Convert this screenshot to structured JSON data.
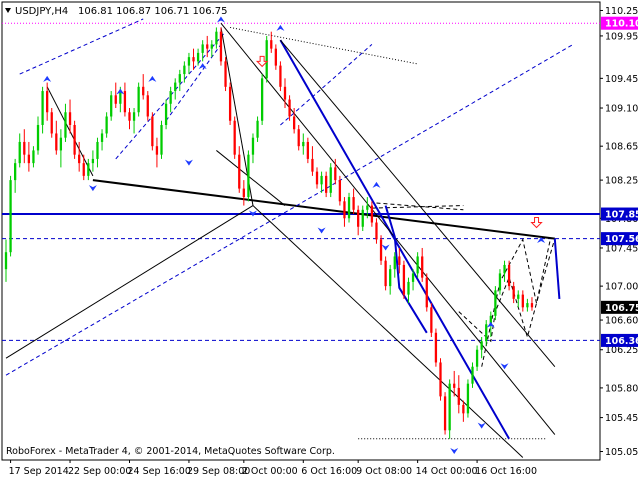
{
  "chart_data": {
    "type": "candlestick",
    "header": {
      "symbol": "USDJPY,H4",
      "ohlc": "106.81 106.87 106.71 106.75"
    },
    "footer": "RoboForex - MetaTrader 4, © 2001-2014, MetaQuotes Software Corp.",
    "ylim": [
      104.95,
      110.35
    ],
    "xlim": [
      0,
      129
    ],
    "y_ticks": [
      "110.25",
      "109.95",
      "109.45",
      "109.10",
      "108.65",
      "108.25",
      "107.80",
      "107.45",
      "107.00",
      "106.60",
      "106.25",
      "105.80",
      "105.45",
      "105.05"
    ],
    "x_ticks": [
      {
        "label": "17 Sep 2014",
        "x": 1
      },
      {
        "label": "22 Sep 00:00",
        "x": 14
      },
      {
        "label": "24 Sep 16:00",
        "x": 27
      },
      {
        "label": "29 Sep 08:00",
        "x": 40
      },
      {
        "label": "2 Oct 00:00",
        "x": 52
      },
      {
        "label": "6 Oct 16:00",
        "x": 65
      },
      {
        "label": "9 Oct 08:00",
        "x": 77
      },
      {
        "label": "14 Oct 00:00",
        "x": 90
      },
      {
        "label": "16 Oct 16:00",
        "x": 103
      }
    ],
    "price_labels": [
      {
        "value": 110.1,
        "text": "110.10",
        "bg": "#ff00ff",
        "fg": "#ffffff"
      },
      {
        "value": 107.85,
        "text": "107.85",
        "bg": "#0000cc",
        "fg": "#ffffff"
      },
      {
        "value": 107.56,
        "text": "107.56",
        "bg": "#0000cc",
        "fg": "#ffffff"
      },
      {
        "value": 106.75,
        "text": "106.75",
        "bg": "#000000",
        "fg": "#ffffff"
      },
      {
        "value": 106.36,
        "text": "106.36",
        "bg": "#0000cc",
        "fg": "#ffffff"
      }
    ],
    "horizontal_levels": [
      {
        "value": 110.1,
        "color": "#ff00ff",
        "style": "dotted",
        "width": 1
      },
      {
        "value": 107.85,
        "color": "#0000cc",
        "style": "solid",
        "width": 2
      },
      {
        "value": 107.56,
        "color": "#0000cc",
        "style": "dashed",
        "width": 1
      },
      {
        "value": 106.36,
        "color": "#0000cc",
        "style": "dashed",
        "width": 1
      }
    ],
    "trendlines": [
      {
        "x1": 49,
        "y1": 110.05,
        "x2": 90,
        "y2": 109.62,
        "color": "#000000",
        "style": "dotted",
        "width": 1
      },
      {
        "x1": 77,
        "y1": 105.2,
        "x2": 118,
        "y2": 105.2,
        "color": "#000000",
        "style": "dotted",
        "width": 1
      },
      {
        "x1": 19,
        "y1": 108.25,
        "x2": 120,
        "y2": 107.56,
        "color": "#000000",
        "style": "solid",
        "width": 2
      },
      {
        "x1": 60,
        "y1": 109.9,
        "x2": 110,
        "y2": 105.2,
        "color": "#0000cc",
        "style": "solid",
        "width": 2
      },
      {
        "x1": 0,
        "y1": 106.15,
        "x2": 54,
        "y2": 107.95,
        "color": "#000000",
        "style": "solid",
        "width": 1
      },
      {
        "x1": 0,
        "y1": 105.95,
        "x2": 124,
        "y2": 109.85,
        "color": "#0000cc",
        "style": "dashed",
        "width": 1
      },
      {
        "x1": 47,
        "y1": 110.1,
        "x2": 120,
        "y2": 105.25,
        "color": "#000000",
        "style": "solid",
        "width": 1
      },
      {
        "x1": 54,
        "y1": 107.95,
        "x2": 113,
        "y2": 104.98,
        "color": "#000000",
        "style": "solid",
        "width": 1
      },
      {
        "x1": 60,
        "y1": 109.9,
        "x2": 120,
        "y2": 106.05,
        "color": "#000000",
        "style": "solid",
        "width": 1
      },
      {
        "x1": 46,
        "y1": 108.6,
        "x2": 61,
        "y2": 107.95,
        "color": "#000000",
        "style": "solid",
        "width": 1
      },
      {
        "x1": 3,
        "y1": 109.5,
        "x2": 30,
        "y2": 110.15,
        "color": "#0000cc",
        "style": "dashed",
        "width": 1
      },
      {
        "x1": 24,
        "y1": 108.5,
        "x2": 48,
        "y2": 110.0,
        "color": "#0000cc",
        "style": "dashed",
        "width": 1
      },
      {
        "x1": 35,
        "y1": 108.95,
        "x2": 47,
        "y2": 109.85,
        "color": "#0000cc",
        "style": "dashed",
        "width": 1
      },
      {
        "x1": 60,
        "y1": 108.9,
        "x2": 80,
        "y2": 109.85,
        "color": "#0000cc",
        "style": "dashed",
        "width": 1
      },
      {
        "x1": 80,
        "y1": 107.92,
        "x2": 100,
        "y2": 107.95,
        "color": "#000000",
        "style": "dashed",
        "width": 1
      },
      {
        "x1": 81,
        "y1": 107.98,
        "x2": 100,
        "y2": 107.9,
        "color": "#000000",
        "style": "dashed",
        "width": 1
      }
    ],
    "wave_paths": [
      {
        "color": "#0000cc",
        "style": "solid",
        "width": 2,
        "points": [
          [
            83,
            107.95
          ],
          [
            85,
            107.58
          ],
          [
            86,
            106.98
          ],
          [
            92,
            106.45
          ]
        ]
      },
      {
        "color": "#000000",
        "style": "dashed",
        "width": 1,
        "points": [
          [
            99,
            106.7
          ],
          [
            106,
            106.35
          ],
          [
            107,
            106.7
          ],
          [
            110,
            107.1
          ],
          [
            114,
            106.4
          ],
          [
            117,
            107.0
          ],
          [
            120,
            107.56
          ]
        ]
      },
      {
        "color": "#000000",
        "style": "dashed",
        "width": 1,
        "points": [
          [
            104,
            106.05
          ],
          [
            108,
            107.05
          ],
          [
            113,
            107.55
          ],
          [
            116,
            106.8
          ],
          [
            119,
            107.55
          ]
        ]
      },
      {
        "color": "#000000",
        "style": "solid",
        "width": 1,
        "points": [
          [
            9,
            109.35
          ],
          [
            19,
            108.3
          ]
        ]
      },
      {
        "color": "#000000",
        "style": "solid",
        "width": 1,
        "points": [
          [
            47,
            110.05
          ],
          [
            54,
            107.95
          ]
        ]
      },
      {
        "color": "#0000cc",
        "style": "solid",
        "width": 2,
        "points": [
          [
            120,
            107.56
          ],
          [
            121,
            106.85
          ]
        ]
      }
    ],
    "candle_colors": {
      "up": "#00cc00",
      "down": "#ff0000"
    },
    "candles": [
      [
        107.2,
        107.55,
        107.05,
        107.4
      ],
      [
        107.4,
        108.3,
        107.35,
        108.25
      ],
      [
        108.25,
        108.5,
        108.1,
        108.45
      ],
      [
        108.45,
        108.8,
        108.4,
        108.7
      ],
      [
        108.7,
        108.85,
        108.45,
        108.55
      ],
      [
        108.55,
        108.7,
        108.35,
        108.45
      ],
      [
        108.45,
        108.65,
        108.4,
        108.6
      ],
      [
        108.6,
        109.0,
        108.55,
        108.9
      ],
      [
        108.9,
        109.35,
        108.8,
        109.3
      ],
      [
        109.3,
        109.4,
        108.95,
        109.05
      ],
      [
        109.05,
        109.1,
        108.75,
        108.8
      ],
      [
        108.8,
        108.95,
        108.55,
        108.6
      ],
      [
        108.6,
        108.85,
        108.4,
        108.75
      ],
      [
        108.75,
        109.15,
        108.7,
        109.05
      ],
      [
        109.05,
        109.2,
        108.8,
        108.9
      ],
      [
        108.9,
        108.95,
        108.5,
        108.55
      ],
      [
        108.55,
        108.7,
        108.35,
        108.45
      ],
      [
        108.45,
        108.55,
        108.25,
        108.3
      ],
      [
        108.3,
        108.5,
        108.25,
        108.45
      ],
      [
        108.45,
        108.6,
        108.35,
        108.5
      ],
      [
        108.5,
        108.75,
        108.4,
        108.7
      ],
      [
        108.7,
        108.85,
        108.6,
        108.8
      ],
      [
        108.8,
        109.05,
        108.75,
        109.0
      ],
      [
        109.0,
        109.3,
        108.95,
        109.25
      ],
      [
        109.25,
        109.4,
        109.1,
        109.15
      ],
      [
        109.15,
        109.35,
        109.05,
        109.3
      ],
      [
        109.3,
        109.4,
        109.0,
        109.05
      ],
      [
        109.05,
        109.1,
        108.85,
        108.95
      ],
      [
        108.95,
        109.1,
        108.8,
        109.05
      ],
      [
        109.05,
        109.4,
        109.0,
        109.35
      ],
      [
        109.35,
        109.5,
        109.2,
        109.25
      ],
      [
        109.25,
        109.3,
        108.95,
        109.0
      ],
      [
        109.0,
        109.05,
        108.6,
        108.65
      ],
      [
        108.65,
        108.75,
        108.4,
        108.55
      ],
      [
        108.55,
        108.95,
        108.5,
        108.9
      ],
      [
        108.9,
        109.2,
        108.85,
        109.15
      ],
      [
        109.15,
        109.35,
        109.05,
        109.3
      ],
      [
        109.3,
        109.45,
        109.2,
        109.4
      ],
      [
        109.4,
        109.55,
        109.3,
        109.5
      ],
      [
        109.5,
        109.65,
        109.4,
        109.6
      ],
      [
        109.6,
        109.75,
        109.5,
        109.7
      ],
      [
        109.7,
        109.8,
        109.55,
        109.65
      ],
      [
        109.65,
        109.8,
        109.6,
        109.75
      ],
      [
        109.75,
        109.9,
        109.65,
        109.85
      ],
      [
        109.85,
        109.95,
        109.7,
        109.8
      ],
      [
        109.8,
        109.9,
        109.7,
        109.85
      ],
      [
        109.85,
        110.05,
        109.8,
        110.0
      ],
      [
        110.0,
        110.05,
        109.6,
        109.65
      ],
      [
        109.65,
        109.7,
        109.3,
        109.35
      ],
      [
        109.35,
        109.4,
        108.9,
        108.95
      ],
      [
        108.95,
        109.0,
        108.5,
        108.55
      ],
      [
        108.55,
        108.65,
        108.1,
        108.15
      ],
      [
        108.15,
        108.25,
        107.95,
        108.05
      ],
      [
        108.05,
        108.6,
        108.0,
        108.55
      ],
      [
        108.55,
        108.8,
        108.45,
        108.75
      ],
      [
        108.75,
        109.0,
        108.7,
        108.95
      ],
      [
        108.95,
        109.5,
        108.9,
        109.45
      ],
      [
        109.45,
        109.95,
        109.4,
        109.9
      ],
      [
        109.9,
        110.0,
        109.75,
        109.8
      ],
      [
        109.8,
        109.85,
        109.55,
        109.6
      ],
      [
        109.6,
        109.65,
        109.3,
        109.35
      ],
      [
        109.35,
        109.45,
        109.1,
        109.2
      ],
      [
        109.2,
        109.25,
        108.95,
        109.0
      ],
      [
        109.0,
        109.1,
        108.8,
        108.85
      ],
      [
        108.85,
        108.9,
        108.6,
        108.65
      ],
      [
        108.65,
        108.8,
        108.55,
        108.7
      ],
      [
        108.7,
        108.75,
        108.45,
        108.5
      ],
      [
        108.5,
        108.65,
        108.3,
        108.35
      ],
      [
        108.35,
        108.4,
        108.15,
        108.2
      ],
      [
        108.2,
        108.35,
        108.1,
        108.3
      ],
      [
        108.3,
        108.35,
        108.05,
        108.1
      ],
      [
        108.1,
        108.45,
        108.05,
        108.4
      ],
      [
        108.4,
        108.5,
        108.2,
        108.25
      ],
      [
        108.25,
        108.3,
        107.95,
        108.0
      ],
      [
        108.0,
        108.05,
        107.7,
        107.8
      ],
      [
        107.8,
        108.1,
        107.75,
        108.05
      ],
      [
        108.05,
        108.15,
        107.85,
        107.9
      ],
      [
        107.9,
        107.95,
        107.6,
        107.7
      ],
      [
        107.7,
        107.95,
        107.65,
        107.9
      ],
      [
        107.9,
        108.05,
        107.8,
        107.95
      ],
      [
        107.95,
        108.0,
        107.7,
        107.75
      ],
      [
        107.75,
        107.8,
        107.5,
        107.55
      ],
      [
        107.55,
        107.6,
        107.25,
        107.3
      ],
      [
        107.3,
        107.35,
        106.95,
        107.0
      ],
      [
        107.0,
        107.25,
        106.9,
        107.2
      ],
      [
        107.2,
        107.4,
        107.1,
        107.35
      ],
      [
        107.35,
        107.45,
        107.15,
        107.25
      ],
      [
        107.25,
        107.3,
        106.85,
        106.9
      ],
      [
        106.9,
        107.1,
        106.8,
        107.05
      ],
      [
        107.05,
        107.2,
        106.95,
        107.15
      ],
      [
        107.15,
        107.4,
        107.1,
        107.35
      ],
      [
        107.35,
        107.45,
        107.05,
        107.1
      ],
      [
        107.1,
        107.15,
        106.7,
        106.75
      ],
      [
        106.75,
        106.8,
        106.4,
        106.45
      ],
      [
        106.45,
        106.5,
        106.05,
        106.1
      ],
      [
        106.1,
        106.15,
        105.65,
        105.7
      ],
      [
        105.7,
        105.75,
        105.25,
        105.3
      ],
      [
        105.3,
        105.9,
        105.2,
        105.85
      ],
      [
        105.85,
        106.0,
        105.7,
        105.8
      ],
      [
        105.8,
        105.95,
        105.5,
        105.6
      ],
      [
        105.6,
        105.65,
        105.4,
        105.5
      ],
      [
        105.5,
        105.9,
        105.45,
        105.85
      ],
      [
        105.85,
        106.1,
        105.8,
        106.05
      ],
      [
        106.05,
        106.3,
        106.0,
        106.25
      ],
      [
        106.25,
        106.4,
        106.15,
        106.35
      ],
      [
        106.35,
        106.6,
        106.3,
        106.55
      ],
      [
        106.55,
        106.7,
        106.4,
        106.65
      ],
      [
        106.65,
        107.0,
        106.6,
        106.95
      ],
      [
        106.95,
        107.2,
        106.9,
        107.15
      ],
      [
        107.15,
        107.3,
        107.05,
        107.25
      ],
      [
        107.25,
        107.3,
        106.95,
        107.0
      ],
      [
        107.0,
        107.05,
        106.8,
        106.85
      ],
      [
        106.85,
        106.95,
        106.75,
        106.9
      ],
      [
        106.9,
        106.95,
        106.7,
        106.75
      ],
      [
        106.75,
        106.85,
        106.7,
        106.8
      ],
      [
        106.8,
        106.87,
        106.71,
        106.75
      ]
    ],
    "fractals": {
      "up": [
        [
          9,
          109.35
        ],
        [
          25,
          109.2
        ],
        [
          32,
          109.35
        ],
        [
          43,
          109.5
        ],
        [
          47,
          110.05
        ],
        [
          60,
          109.95
        ],
        [
          81,
          108.1
        ],
        [
          106,
          106.45
        ],
        [
          117,
          107.45
        ]
      ],
      "down": [
        [
          19,
          108.25
        ],
        [
          40,
          108.55
        ],
        [
          54,
          107.95
        ],
        [
          69,
          107.75
        ],
        [
          83,
          107.55
        ],
        [
          98,
          105.15
        ],
        [
          104,
          105.45
        ],
        [
          109,
          106.15
        ]
      ]
    },
    "arrow_markers": [
      {
        "x": 56,
        "y": 109.65
      },
      {
        "x": 116,
        "y": 107.75
      }
    ]
  }
}
